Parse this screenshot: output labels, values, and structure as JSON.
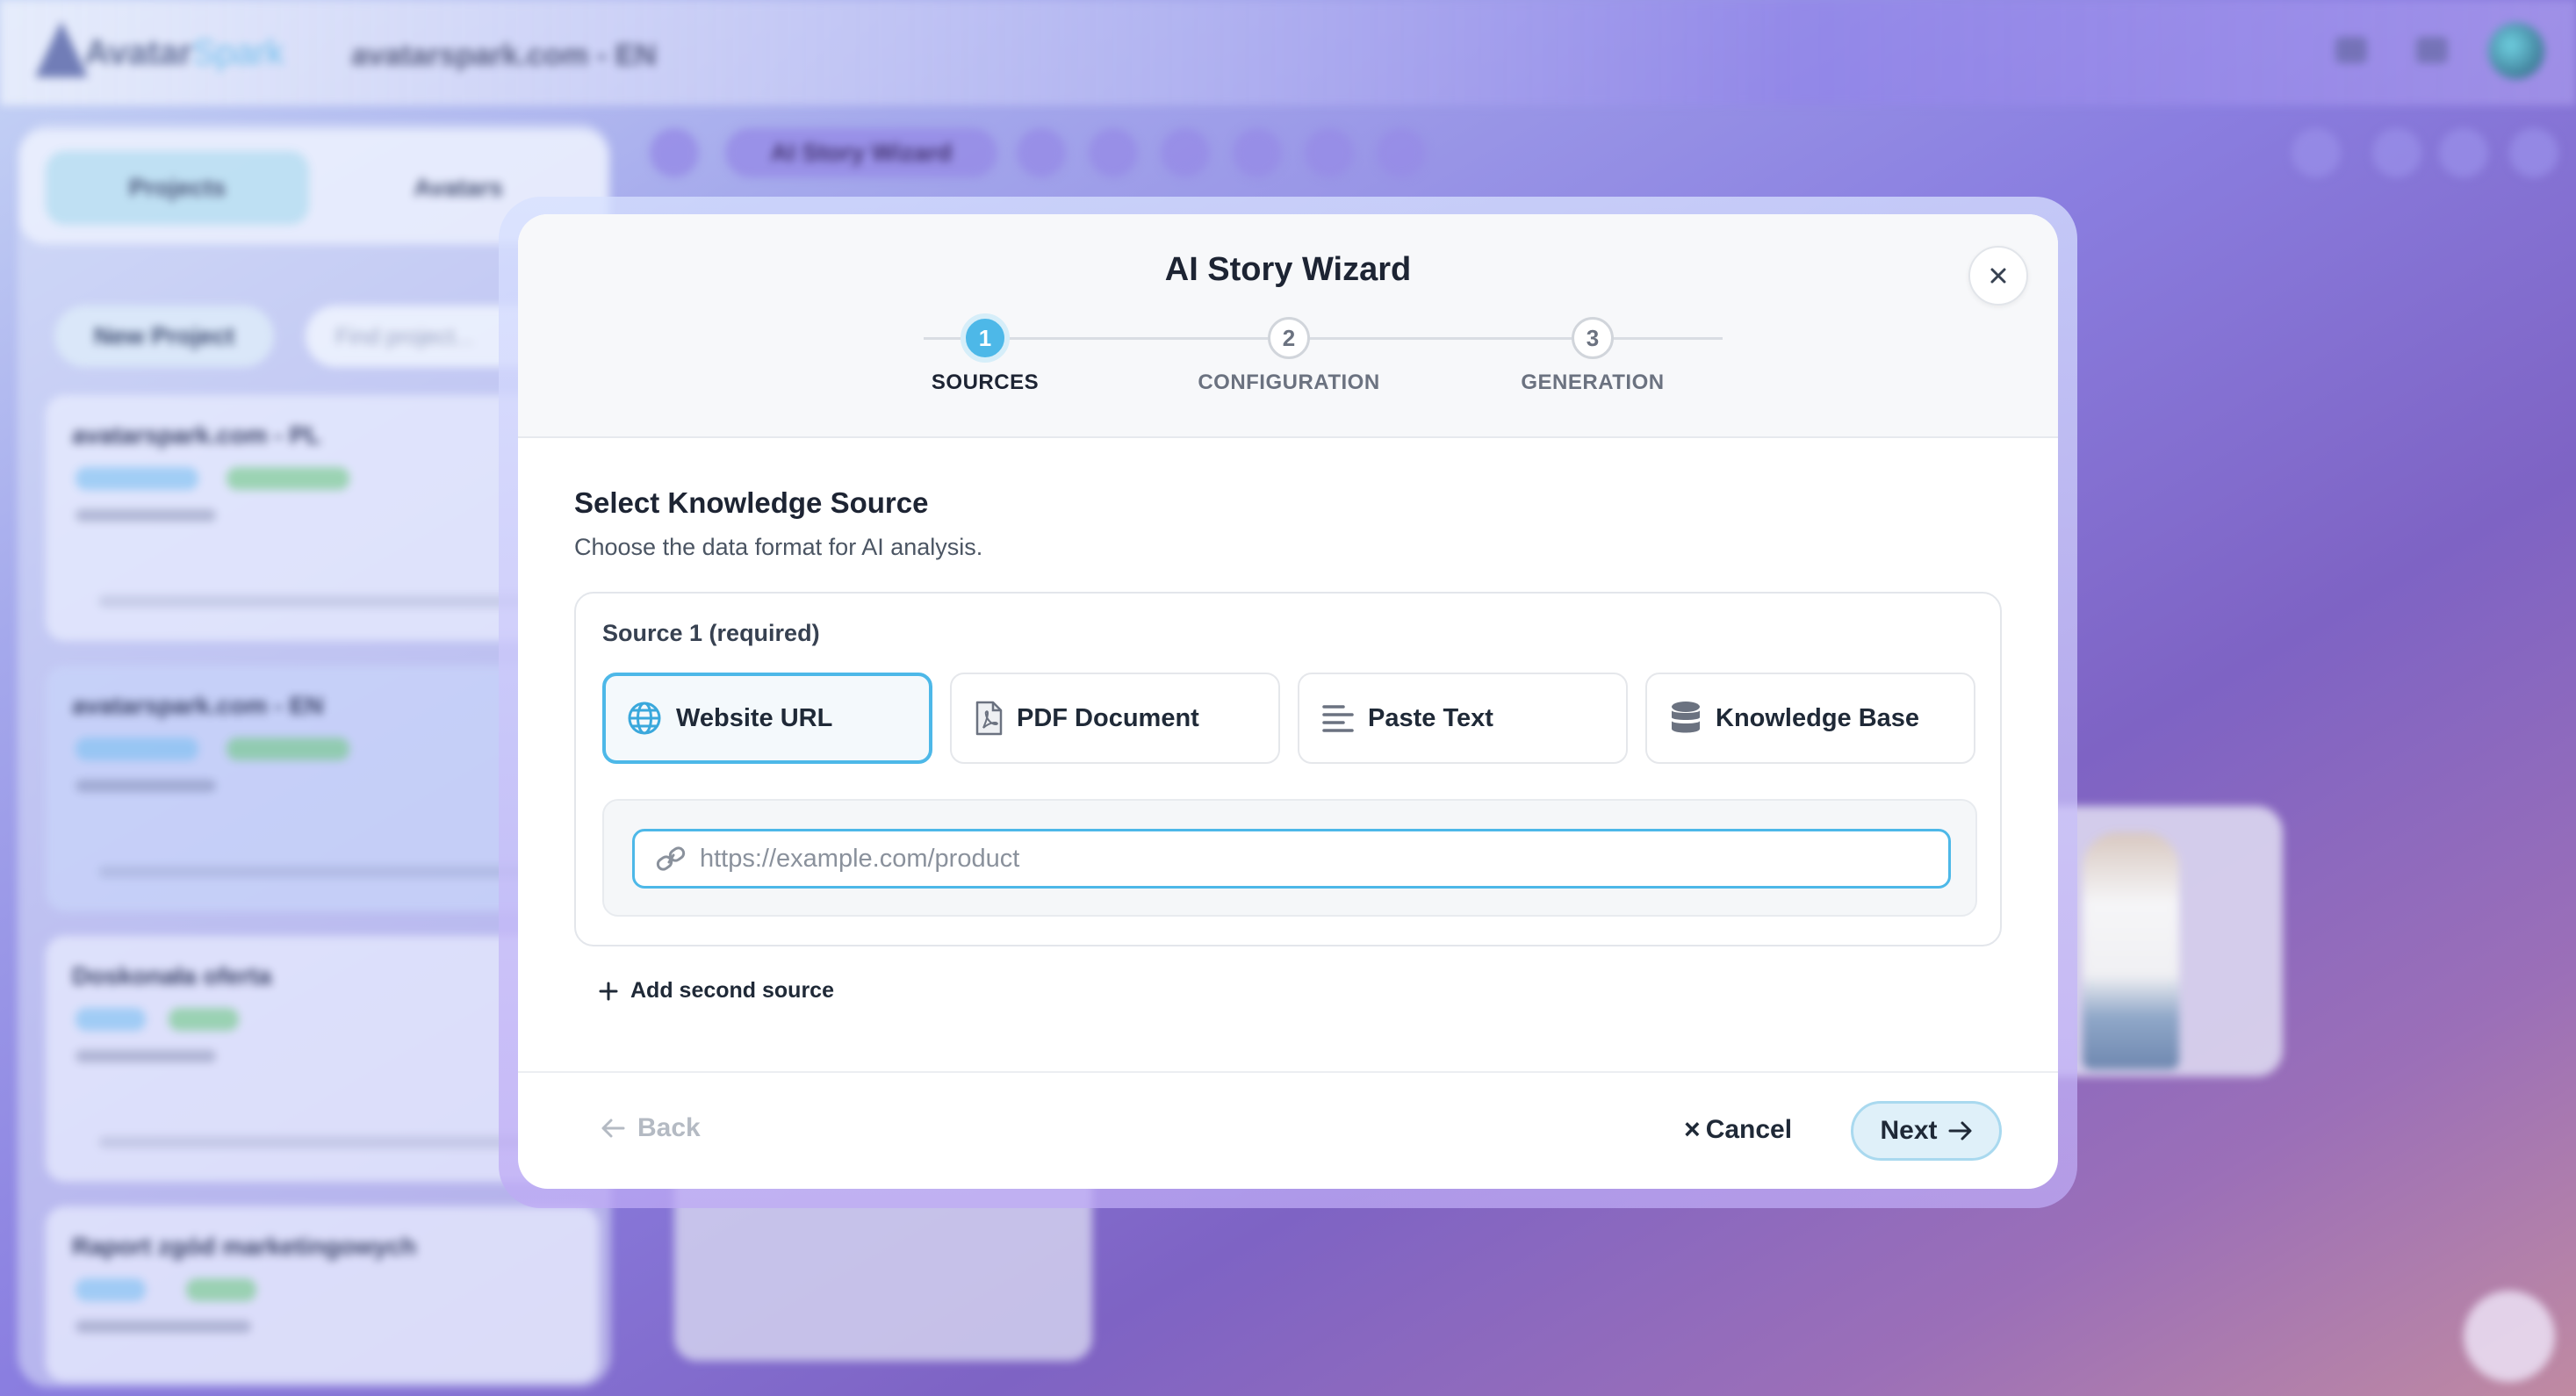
{
  "app": {
    "logo_main": "Avatar",
    "logo_accent": "Spark",
    "project_title": "avatarspark.com - EN"
  },
  "sidebar": {
    "tabs": [
      "Projects",
      "Avatars"
    ],
    "new_project_label": "New Project",
    "search_placeholder": "Find project...",
    "projects": [
      {
        "name": "avatarspark.com - PL"
      },
      {
        "name": "avatarspark.com - EN"
      },
      {
        "name": "Doskonała oferta"
      },
      {
        "name": "Raport zgód marketingowych"
      }
    ]
  },
  "canvas": {
    "story_button_label": "AI Story Wizard"
  },
  "modal": {
    "title": "AI Story Wizard",
    "steps": [
      {
        "number": "1",
        "label": "SOURCES",
        "active": true
      },
      {
        "number": "2",
        "label": "CONFIGURATION",
        "active": false
      },
      {
        "number": "3",
        "label": "GENERATION",
        "active": false
      }
    ],
    "section_title": "Select Knowledge Source",
    "section_subtitle": "Choose the data format for AI analysis.",
    "source_label": "Source 1 (required)",
    "source_options": [
      {
        "label": "Website URL",
        "icon": "globe-icon",
        "selected": true
      },
      {
        "label": "PDF Document",
        "icon": "pdf-file-icon",
        "selected": false
      },
      {
        "label": "Paste Text",
        "icon": "text-lines-icon",
        "selected": false
      },
      {
        "label": "Knowledge Base",
        "icon": "database-icon",
        "selected": false
      }
    ],
    "url_input": {
      "value": "",
      "placeholder": "https://example.com/product"
    },
    "add_source_label": "Add second source",
    "footer": {
      "back_label": "Back",
      "cancel_label": "Cancel",
      "next_label": "Next"
    }
  },
  "colors": {
    "accent": "#4db8e8",
    "accent_light": "#dff0f9",
    "text_primary": "#1d2433",
    "text_muted": "#6b7280"
  }
}
